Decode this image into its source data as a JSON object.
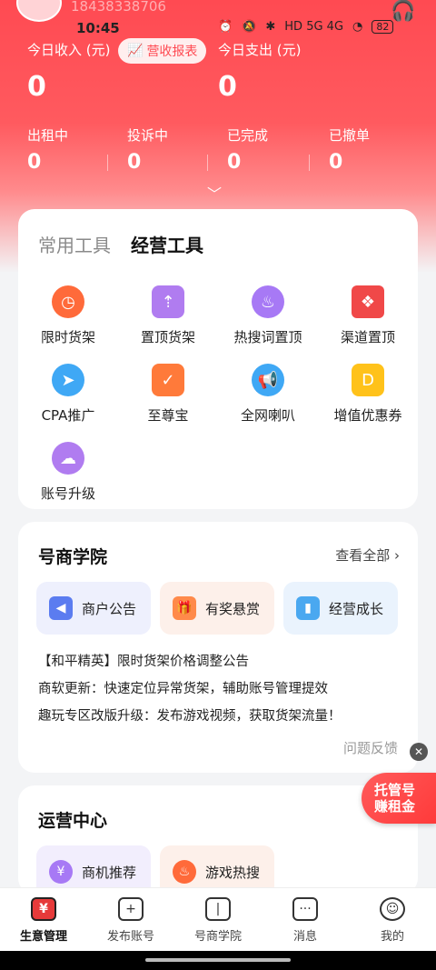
{
  "status": {
    "phone": "18438338706",
    "time": "10:45",
    "network": "HD 5G 4G",
    "battery": "82"
  },
  "header": {
    "income_label": "今日收入 (元)",
    "report_button": "营收报表",
    "expense_label": "今日支出 (元)",
    "income_value": "0",
    "expense_value": "0",
    "stats": [
      {
        "label": "出租中",
        "value": "0"
      },
      {
        "label": "投诉中",
        "value": "0"
      },
      {
        "label": "已完成",
        "value": "0"
      },
      {
        "label": "已撤单",
        "value": "0"
      }
    ]
  },
  "tools": {
    "tabs": [
      {
        "label": "常用工具",
        "active": false
      },
      {
        "label": "经营工具",
        "active": true
      }
    ],
    "items": [
      {
        "label": "限时货架",
        "icon": "clock-icon",
        "color": "#ff6a3a"
      },
      {
        "label": "置顶货架",
        "icon": "pin-top-icon",
        "color": "#b07cf0"
      },
      {
        "label": "热搜词置顶",
        "icon": "flame-icon",
        "color": "#a779f5"
      },
      {
        "label": "渠道置顶",
        "icon": "cubes-icon",
        "color": "#f04848"
      },
      {
        "label": "CPA推广",
        "icon": "paper-plane-icon",
        "color": "#3fa8f5"
      },
      {
        "label": "至尊宝",
        "icon": "shield-check-icon",
        "color": "#ff7a3a"
      },
      {
        "label": "全网喇叭",
        "icon": "megaphone-icon",
        "color": "#3fa8f5"
      },
      {
        "label": "增值优惠券",
        "icon": "coupon-icon",
        "color": "#ffc21a"
      },
      {
        "label": "账号升级",
        "icon": "cloud-upload-icon",
        "color": "#b07cf0"
      }
    ]
  },
  "academy": {
    "title": "号商学院",
    "more": "查看全部",
    "buttons": [
      {
        "label": "商户公告",
        "icon": "speaker-icon",
        "color": "#5b7cf0",
        "bg": "#eef0fd"
      },
      {
        "label": "有奖悬赏",
        "icon": "gift-box-icon",
        "color": "#ff8a4a",
        "bg": "#fdf0ea"
      },
      {
        "label": "经营成长",
        "icon": "bookmark-icon",
        "color": "#4aa8f0",
        "bg": "#eaf3fd"
      }
    ],
    "news": [
      "【和平精英】限时货架价格调整公告",
      "商软更新：快速定位异常货架，辅助账号管理提效",
      "趣玩专区改版升级：发布游戏视频，获取货架流量！"
    ],
    "feedback": "问题反馈"
  },
  "promo": {
    "line1": "托管号",
    "line2": "赚租金"
  },
  "ops": {
    "title": "运营中心",
    "buttons": [
      {
        "label": "商机推荐",
        "icon": "yen-bulb-icon",
        "color": "#a779f5",
        "bg": "#f2eefd"
      },
      {
        "label": "游戏热搜",
        "icon": "flame-icon",
        "color": "#ff6a3a",
        "bg": "#fdf0ea"
      }
    ]
  },
  "nav": [
    {
      "label": "生意管理",
      "icon": "wallet-icon",
      "active": true
    },
    {
      "label": "发布账号",
      "icon": "plus-square-icon",
      "active": false
    },
    {
      "label": "号商学院",
      "icon": "book-icon",
      "active": false
    },
    {
      "label": "消息",
      "icon": "chat-bubble-icon",
      "active": false
    },
    {
      "label": "我的",
      "icon": "user-icon",
      "active": false
    }
  ]
}
